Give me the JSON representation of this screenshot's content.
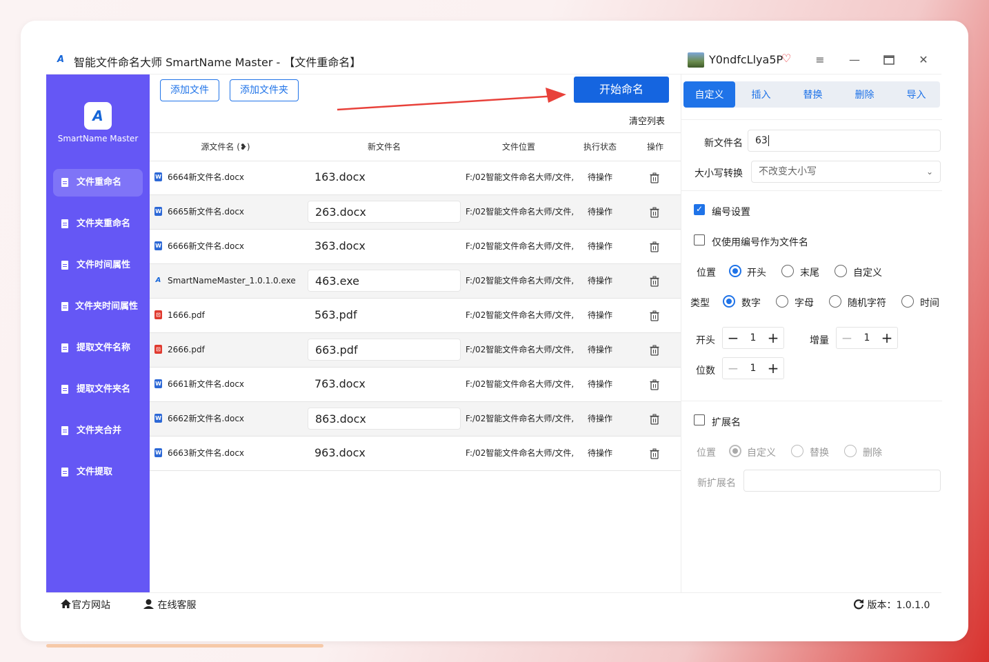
{
  "window": {
    "title": "智能文件命名大师 SmartName Master - 【文件重命名】",
    "username": "Y0ndfcLlya5P",
    "vip_icon": "heart-diamond-icon",
    "controls": [
      "menu-icon",
      "minimize-icon",
      "maximize-icon",
      "close-icon"
    ]
  },
  "sidebar": {
    "logo_text": "SmartName Master",
    "items": [
      {
        "label": "文件重命名",
        "active": true
      },
      {
        "label": "文件夹重命名"
      },
      {
        "label": "文件时间属性"
      },
      {
        "label": "文件夹时间属性"
      },
      {
        "label": "提取文件名称"
      },
      {
        "label": "提取文件夹名"
      },
      {
        "label": "文件夹合并"
      },
      {
        "label": "文件提取"
      }
    ]
  },
  "toolbar": {
    "add_file": "添加文件",
    "add_folder": "添加文件夹",
    "start": "开始命名",
    "clear": "清空列表"
  },
  "table": {
    "headers": [
      "源文件名 (❥)",
      "新文件名",
      "文件位置",
      "执行状态",
      "操作"
    ],
    "rows": [
      {
        "type": "word",
        "src": "6664新文件名.docx",
        "new": "163.docx",
        "loc": "F:/02智能文件命名大师/文件,",
        "status": "待操作"
      },
      {
        "type": "word",
        "src": "6665新文件名.docx",
        "new": "263.docx",
        "loc": "F:/02智能文件命名大师/文件,",
        "status": "待操作"
      },
      {
        "type": "word",
        "src": "6666新文件名.docx",
        "new": "363.docx",
        "loc": "F:/02智能文件命名大师/文件,",
        "status": "待操作"
      },
      {
        "type": "exe",
        "src": "SmartNameMaster_1.0.1.0.exe",
        "new": "463.exe",
        "loc": "F:/02智能文件命名大师/文件,",
        "status": "待操作"
      },
      {
        "type": "pdf",
        "src": "1666.pdf",
        "new": "563.pdf",
        "loc": "F:/02智能文件命名大师/文件,",
        "status": "待操作"
      },
      {
        "type": "pdf",
        "src": "2666.pdf",
        "new": "663.pdf",
        "loc": "F:/02智能文件命名大师/文件,",
        "status": "待操作"
      },
      {
        "type": "word",
        "src": "6661新文件名.docx",
        "new": "763.docx",
        "loc": "F:/02智能文件命名大师/文件,",
        "status": "待操作"
      },
      {
        "type": "word",
        "src": "6662新文件名.docx",
        "new": "863.docx",
        "loc": "F:/02智能文件命名大师/文件,",
        "status": "待操作"
      },
      {
        "type": "word",
        "src": "6663新文件名.docx",
        "new": "963.docx",
        "loc": "F:/02智能文件命名大师/文件,",
        "status": "待操作"
      }
    ]
  },
  "panel": {
    "tabs": [
      "自定义",
      "插入",
      "替换",
      "删除",
      "导入"
    ],
    "new_name_label": "新文件名",
    "new_name_value": "63",
    "case_label": "大小写转换",
    "case_value": "不改变大小写",
    "numbering_label": "编号设置",
    "numbering_checked": true,
    "only_number_label": "仅使用编号作为文件名",
    "only_number_checked": false,
    "position_label": "位置",
    "position_options": [
      "开头",
      "末尾",
      "自定义"
    ],
    "position_selected": "开头",
    "type_label": "类型",
    "type_options": [
      "数字",
      "字母",
      "随机字符",
      "时间"
    ],
    "type_selected": "数字",
    "start_label": "开头",
    "start_value": "1",
    "increment_label": "增量",
    "increment_value": "1",
    "digits_label": "位数",
    "digits_value": "1",
    "ext_label": "扩展名",
    "ext_checked": false,
    "ext_position_label": "位置",
    "ext_options": [
      "自定义",
      "替换",
      "删除"
    ],
    "ext_selected": "自定义",
    "new_ext_label": "新扩展名",
    "new_ext_value": ""
  },
  "footer": {
    "website": "官方网站",
    "support": "在线客服",
    "version": "版本：1.0.1.0"
  },
  "colors": {
    "sidebar": "#6557f5",
    "primary": "#1565e0",
    "annotation_arrow": "#e8413a"
  }
}
